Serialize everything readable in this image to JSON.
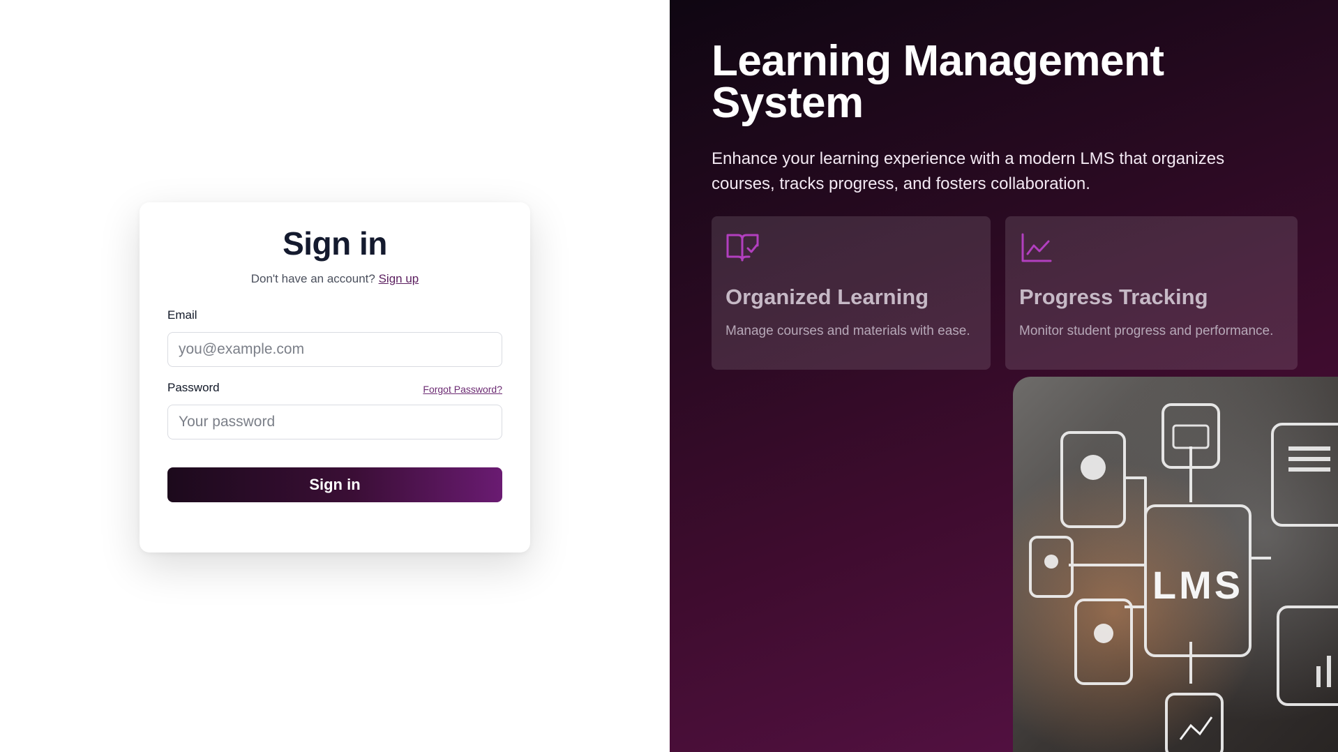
{
  "login": {
    "title": "Sign in",
    "no_account_text": "Don't have an account?",
    "signup_link": "Sign up",
    "email_label": "Email",
    "email_placeholder": "you@example.com",
    "password_label": "Password",
    "forgot_link": "Forgot Password?",
    "password_placeholder": "Your password",
    "submit_label": "Sign in"
  },
  "hero": {
    "title": "Learning Management System",
    "description": "Enhance your learning experience with a modern LMS that organizes courses, tracks progress, and fosters collaboration.",
    "features": [
      {
        "icon": "book-check-icon",
        "title": "Organized Learning",
        "description": "Manage courses and materials with ease."
      },
      {
        "icon": "line-chart-icon",
        "title": "Progress Tracking",
        "description": "Monitor student progress and performance."
      }
    ],
    "image_label": "LMS"
  },
  "colors": {
    "brand_dark": "#1c0a1c",
    "brand_purple": "#6a1b72",
    "accent_icon": "#b23fbf",
    "link": "#5a1d5e"
  }
}
